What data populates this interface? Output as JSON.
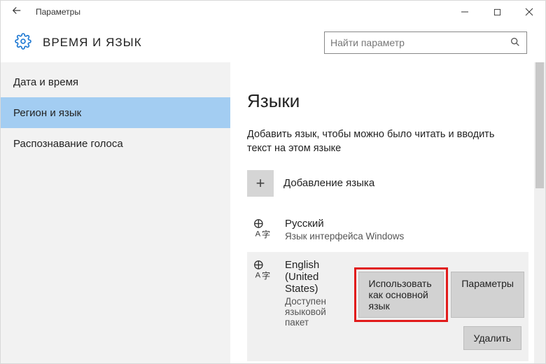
{
  "titlebar": {
    "title": "Параметры"
  },
  "header": {
    "title": "ВРЕМЯ И ЯЗЫК"
  },
  "search": {
    "placeholder": "Найти параметр"
  },
  "sidebar": {
    "items": [
      {
        "label": "Дата и время"
      },
      {
        "label": "Регион и язык"
      },
      {
        "label": "Распознавание голоса"
      }
    ],
    "active_index": 1
  },
  "main": {
    "heading": "Языки",
    "description": "Добавить язык, чтобы можно было читать и вводить текст на этом языке",
    "add_label": "Добавление языка",
    "languages": [
      {
        "name": "Русский",
        "sub": "Язык интерфейса Windows"
      },
      {
        "name": "English (United States)",
        "sub": "Доступен языковой пакет"
      }
    ],
    "buttons": {
      "set_default": "Использовать как основной язык",
      "options": "Параметры",
      "remove": "Удалить"
    }
  }
}
